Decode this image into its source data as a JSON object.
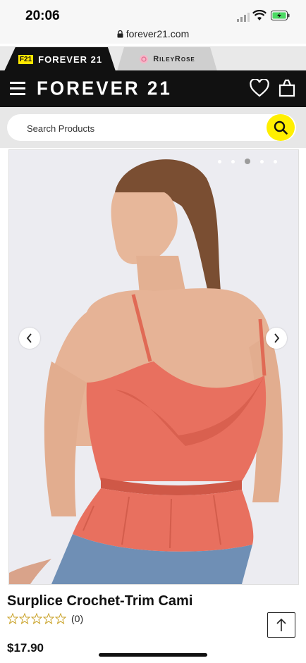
{
  "status_bar": {
    "time": "20:06",
    "url": "forever21.com"
  },
  "brand_tabs": {
    "forever21": {
      "badge": "F21",
      "label": "FOREVER 21"
    },
    "rileyrose": {
      "label": "RileyRose"
    }
  },
  "header": {
    "logo": "FOREVER 21"
  },
  "search": {
    "placeholder": "Search Products"
  },
  "carousel": {
    "dot_count": 5,
    "active_index": 2
  },
  "product": {
    "name": "Surplice Crochet-Trim Cami",
    "rating_count": "(0)",
    "price": "$17.90"
  },
  "colors": {
    "accent_yellow": "#ffef00",
    "header_black": "#111111",
    "top_coral": "#e8705f"
  },
  "icons": [
    "lock-icon",
    "menu-icon",
    "heart-icon",
    "bag-icon",
    "search-icon",
    "chevron-left-icon",
    "chevron-right-icon",
    "arrow-up-icon",
    "star-icon"
  ]
}
